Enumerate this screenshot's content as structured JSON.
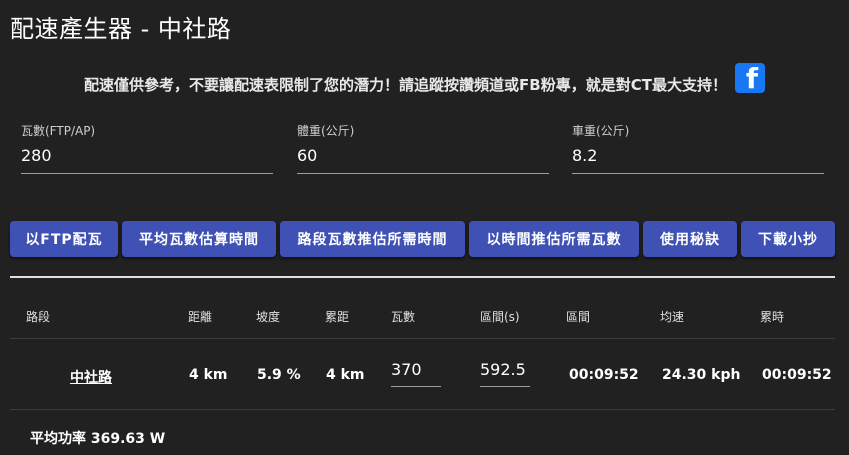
{
  "page": {
    "title": "配速產生器 - 中社路",
    "notice": "配速僅供參考，不要讓配速表限制了您的潛力！請追蹤按讚頻道或FB粉專，就是對CT最大支持！",
    "facebook_icon": "f"
  },
  "fields": {
    "power": {
      "label": "瓦數(FTP/AP)",
      "value": "280"
    },
    "weight": {
      "label": "體重(公斤)",
      "value": "60"
    },
    "bike_weight": {
      "label": "車重(公斤)",
      "value": "8.2"
    }
  },
  "buttons": {
    "ftp": "以FTP配瓦",
    "avg_time": "平均瓦數估算時間",
    "segment_time": "路段瓦數推估所需時間",
    "time_power": "以時間推估所需瓦數",
    "tips": "使用秘訣",
    "download": "下載小抄"
  },
  "table": {
    "headers": {
      "segment": "路段",
      "distance": "距離",
      "grade": "坡度",
      "cum_distance": "累距",
      "power": "瓦數",
      "interval_s": "區間(s)",
      "interval": "區間",
      "speed": "均速",
      "cum_time": "累時"
    },
    "row": {
      "segment": "中社路",
      "distance": "4 km",
      "grade": "5.9 %",
      "cum_distance": "4 km",
      "power": "370",
      "interval_s": "592.5",
      "interval": "00:09:52",
      "speed": "24.30 kph",
      "cum_time": "00:09:52"
    }
  },
  "summary": {
    "avg_power": "平均功率 369.63 W"
  },
  "colors": {
    "background": "#212121",
    "button": "#3f51b5",
    "facebook": "#1877f2"
  }
}
